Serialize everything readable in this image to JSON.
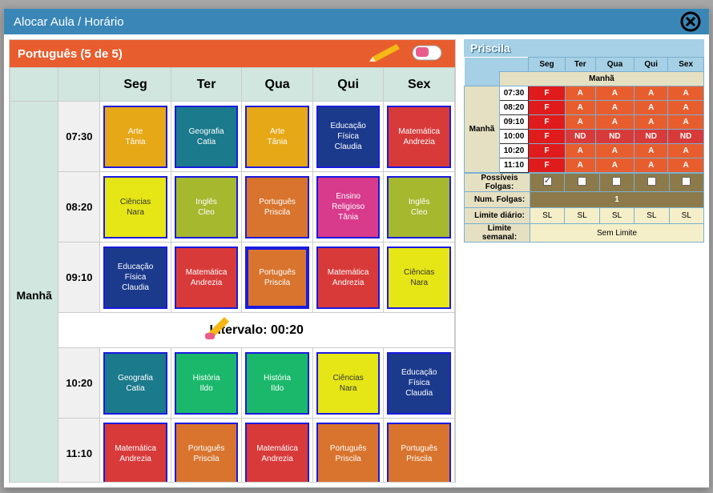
{
  "dialog": {
    "title": "Alocar Aula / Horário"
  },
  "subject": {
    "label": "Português (5 de 5)"
  },
  "days": [
    "Seg",
    "Ter",
    "Qua",
    "Qui",
    "Sex"
  ],
  "period_label": "Manhã",
  "interval_label": "Intervalo: 00:20",
  "rows": [
    {
      "time": "07:30",
      "cells": [
        {
          "subj": "Arte",
          "teacher": "Tânia",
          "color": "c-orange"
        },
        {
          "subj": "Geografia",
          "teacher": "Catia",
          "color": "c-teal"
        },
        {
          "subj": "Arte",
          "teacher": "Tânia",
          "color": "c-orange"
        },
        {
          "subj": "Educação Física",
          "teacher": "Claudia",
          "color": "c-darkblue"
        },
        {
          "subj": "Matemática",
          "teacher": "Andrezia",
          "color": "c-red"
        }
      ]
    },
    {
      "time": "08:20",
      "cells": [
        {
          "subj": "Ciências",
          "teacher": "Nara",
          "color": "c-yellow"
        },
        {
          "subj": "Inglês",
          "teacher": "Cleo",
          "color": "c-olive"
        },
        {
          "subj": "Português",
          "teacher": "Priscila",
          "color": "c-brown"
        },
        {
          "subj": "Ensino Religioso",
          "teacher": "Tânia",
          "color": "c-magenta"
        },
        {
          "subj": "Inglês",
          "teacher": "Cleo",
          "color": "c-olive"
        }
      ]
    },
    {
      "time": "09:10",
      "cells": [
        {
          "subj": "Educação Física",
          "teacher": "Claudia",
          "color": "c-darkblue"
        },
        {
          "subj": "Matemática",
          "teacher": "Andrezia",
          "color": "c-red"
        },
        {
          "subj": "Português",
          "teacher": "Priscila",
          "color": "c-brown",
          "sel": true
        },
        {
          "subj": "Matemática",
          "teacher": "Andrezia",
          "color": "c-red"
        },
        {
          "subj": "Ciências",
          "teacher": "Nara",
          "color": "c-yellow"
        }
      ]
    },
    {
      "time": "10:20",
      "cells": [
        {
          "subj": "Geografia",
          "teacher": "Catia",
          "color": "c-teal"
        },
        {
          "subj": "História",
          "teacher": "Ildo",
          "color": "c-green"
        },
        {
          "subj": "História",
          "teacher": "Ildo",
          "color": "c-green"
        },
        {
          "subj": "Ciências",
          "teacher": "Nara",
          "color": "c-yellow"
        },
        {
          "subj": "Educação Física",
          "teacher": "Claudia",
          "color": "c-darkblue"
        }
      ]
    },
    {
      "time": "11:10",
      "cells": [
        {
          "subj": "Matemática",
          "teacher": "Andrezia",
          "color": "c-red"
        },
        {
          "subj": "Português",
          "teacher": "Priscila",
          "color": "c-brown"
        },
        {
          "subj": "Matemática",
          "teacher": "Andrezia",
          "color": "c-red"
        },
        {
          "subj": "Português",
          "teacher": "Priscila",
          "color": "c-brown"
        },
        {
          "subj": "Português",
          "teacher": "Priscila",
          "color": "c-brown"
        }
      ]
    }
  ],
  "teacher_panel": {
    "name": "Priscila",
    "period": "Manhã",
    "rows": [
      {
        "time": "07:30",
        "status": [
          "F",
          "A",
          "A",
          "A",
          "A"
        ]
      },
      {
        "time": "08:20",
        "status": [
          "F",
          "A",
          "A",
          "A",
          "A"
        ]
      },
      {
        "time": "09:10",
        "status": [
          "F",
          "A",
          "A",
          "A",
          "A"
        ]
      },
      {
        "time": "10:00",
        "status": [
          "F",
          "ND",
          "ND",
          "ND",
          "ND"
        ]
      },
      {
        "time": "10:20",
        "status": [
          "F",
          "A",
          "A",
          "A",
          "A"
        ]
      },
      {
        "time": "11:10",
        "status": [
          "F",
          "A",
          "A",
          "A",
          "A"
        ]
      }
    ],
    "folgas_label": "Possíveis Folgas:",
    "folgas": [
      true,
      false,
      false,
      false,
      false
    ],
    "num_folgas_label": "Num. Folgas:",
    "num_folgas": "1",
    "limite_diario_label": "Limite diário:",
    "limite_diario": [
      "SL",
      "SL",
      "SL",
      "SL",
      "SL"
    ],
    "limite_semanal_label": "Limite semanal:",
    "limite_semanal": "Sem Limite"
  }
}
